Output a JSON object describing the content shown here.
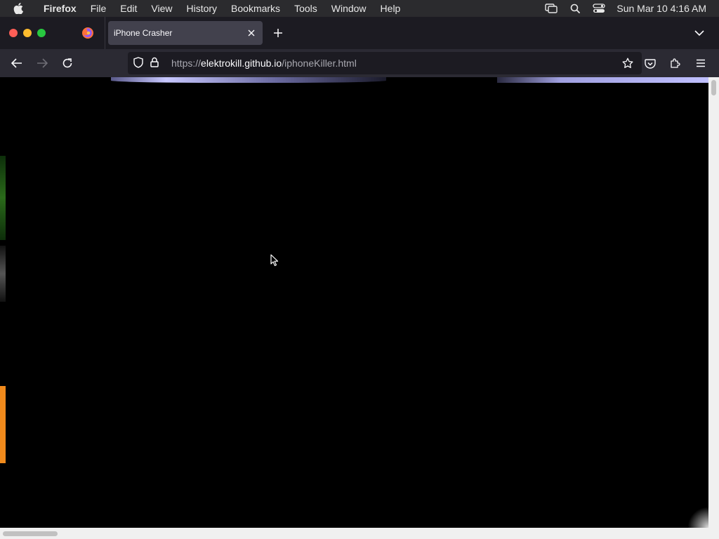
{
  "menubar": {
    "app_name": "Firefox",
    "items": [
      "File",
      "Edit",
      "View",
      "History",
      "Bookmarks",
      "Tools",
      "Window",
      "Help"
    ],
    "clock": "Sun Mar 10  4:16 AM"
  },
  "tabs": [
    {
      "title": "iPhone Crasher",
      "active": true
    }
  ],
  "urlbar": {
    "scheme": "https://",
    "host": "elektrokill.github.io",
    "path": "/iphoneKiller.html"
  },
  "icons": {
    "menubar": [
      "apple-icon",
      "screen-mirror-icon",
      "spotlight-search-icon",
      "control-center-icon"
    ],
    "nav": [
      "back-icon",
      "forward-icon",
      "reload-icon",
      "shield-icon",
      "lock-icon",
      "bookmark-star-icon",
      "pocket-icon",
      "extensions-icon",
      "menu-icon"
    ]
  },
  "colors": {
    "menubar_bg": "#2b2b2e",
    "tabstrip_bg": "#1c1b22",
    "active_tab_bg": "#42414d",
    "navbar_bg": "#2b2a33",
    "urlbar_bg": "#1c1b22",
    "content_bg": "#000000",
    "accent_orange": "#f08a1c"
  }
}
